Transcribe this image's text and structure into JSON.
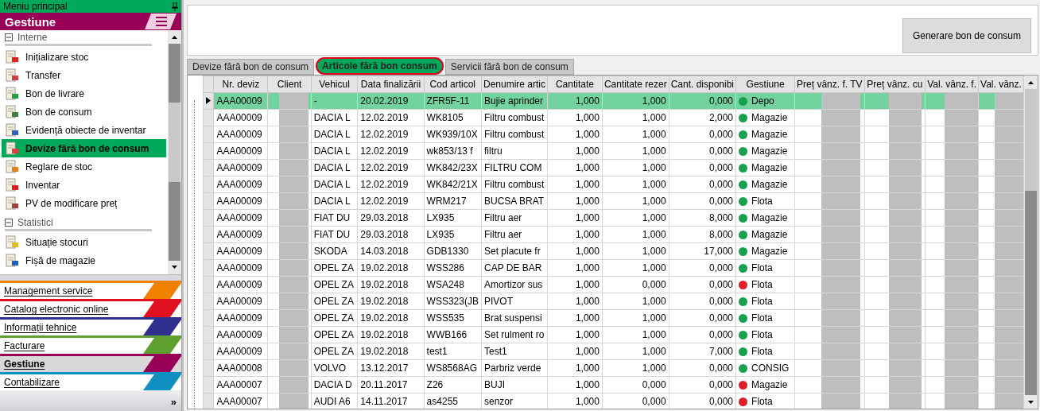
{
  "sidebar": {
    "title": "Meniu principal",
    "section": "Gestiune",
    "groups": [
      {
        "label": "Interne",
        "expanded": true,
        "items": [
          {
            "label": "Inițializare stoc",
            "selected": false,
            "color": "#e02020"
          },
          {
            "label": "Transfer",
            "selected": false,
            "color": "#d04040"
          },
          {
            "label": "Bon de livrare",
            "selected": false,
            "color": "#20a040"
          },
          {
            "label": "Bon de consum",
            "selected": false,
            "color": "#408040"
          },
          {
            "label": "Evidență obiecte de inventar",
            "selected": false,
            "color": "#3060c0"
          },
          {
            "label": "Devize fără bon de consum",
            "selected": true,
            "color": "#e04040"
          },
          {
            "label": "Reglare de stoc",
            "selected": false,
            "color": "#e08020"
          },
          {
            "label": "Inventar",
            "selected": false,
            "color": "#e02020"
          },
          {
            "label": "PV de modificare preț",
            "selected": false,
            "color": "#a04040"
          }
        ]
      },
      {
        "label": "Statistici",
        "expanded": true,
        "items": [
          {
            "label": "Situație stocuri",
            "selected": false,
            "color": "#e0c020"
          },
          {
            "label": "Fișă de magazie",
            "selected": false,
            "color": "#2060c0"
          }
        ]
      }
    ],
    "nav": [
      {
        "label": "Management service",
        "color": "#f08000",
        "selected": false
      },
      {
        "label": "Catalog electronic online",
        "color": "#e01020",
        "selected": false
      },
      {
        "label": "Informații tehnice",
        "color": "#303090",
        "selected": false
      },
      {
        "label": "Facturare",
        "color": "#60a030",
        "selected": false
      },
      {
        "label": "Gestiune",
        "color": "#980058",
        "selected": true
      },
      {
        "label": "Contabilizare",
        "color": "#1090c0",
        "selected": false
      }
    ],
    "more": "»"
  },
  "toolbar": {
    "button": "Generare bon de consum"
  },
  "tabs": [
    {
      "label": "Devize fără bon de consum",
      "selected": false
    },
    {
      "label": "Articole fără bon consum",
      "selected": true
    },
    {
      "label": "Servicii fără bon de consum",
      "selected": false
    }
  ],
  "table": {
    "columns": [
      {
        "label": "Nr. deviz",
        "kind": "text"
      },
      {
        "label": "Client",
        "kind": "redacted"
      },
      {
        "label": "Vehicul",
        "kind": "text"
      },
      {
        "label": "Data finalizării",
        "kind": "text"
      },
      {
        "label": "Cod articol",
        "kind": "text"
      },
      {
        "label": "Denumire artic",
        "kind": "text"
      },
      {
        "label": "Cantitate",
        "kind": "number"
      },
      {
        "label": "Cantitate rezer",
        "kind": "number"
      },
      {
        "label": "Cant. disponibi",
        "kind": "number"
      },
      {
        "label": "Gestiune",
        "kind": "status"
      },
      {
        "label": "Preț vânz. f. TV",
        "kind": "redacted"
      },
      {
        "label": "Preț vânz. cu",
        "kind": "redacted"
      },
      {
        "label": "Val. vânz. f.",
        "kind": "redacted"
      },
      {
        "label": "Val. vânz.",
        "kind": "redacted"
      }
    ],
    "rows": [
      {
        "selected": true,
        "color": "#16a050",
        "cells": [
          "AAA00009",
          "",
          "-",
          "20.02.2019",
          "ZFR5F-11",
          "Bujie aprinder",
          "1,000",
          "1,000",
          "0,000",
          "Depo"
        ]
      },
      {
        "selected": false,
        "color": "#16a050",
        "cells": [
          "AAA00009",
          "",
          "DACIA L",
          "12.02.2019",
          "WK8105",
          "Filtru combust",
          "1,000",
          "1,000",
          "2,000",
          "Magazie"
        ]
      },
      {
        "selected": false,
        "color": "#16a050",
        "cells": [
          "AAA00009",
          "",
          "DACIA L",
          "12.02.2019",
          "WK939/10X",
          "Filtru combust",
          "1,000",
          "1,000",
          "0,000",
          "Magazie"
        ]
      },
      {
        "selected": false,
        "color": "#16a050",
        "cells": [
          "AAA00009",
          "",
          "DACIA L",
          "12.02.2019",
          "wk853/13 f",
          "filtru",
          "1,000",
          "1,000",
          "0,000",
          "Magazie"
        ]
      },
      {
        "selected": false,
        "color": "#16a050",
        "cells": [
          "AAA00009",
          "",
          "DACIA L",
          "12.02.2019",
          "WK842/23X",
          "FILTRU COM",
          "1,000",
          "1,000",
          "0,000",
          "Magazie"
        ]
      },
      {
        "selected": false,
        "color": "#16a050",
        "cells": [
          "AAA00009",
          "",
          "DACIA L",
          "12.02.2019",
          "WK842/21X",
          "Filtru combust",
          "1,000",
          "1,000",
          "0,000",
          "Magazie"
        ]
      },
      {
        "selected": false,
        "color": "#16a050",
        "cells": [
          "AAA00009",
          "",
          "DACIA L",
          "12.02.2019",
          "WRM217",
          "BUCSA BRAT",
          "1,000",
          "1,000",
          "0,000",
          "Flota"
        ]
      },
      {
        "selected": false,
        "color": "#16a050",
        "cells": [
          "AAA00009",
          "",
          "FIAT DU",
          "29.03.2018",
          "LX935",
          "Filtru aer",
          "1,000",
          "1,000",
          "8,000",
          "Magazie"
        ]
      },
      {
        "selected": false,
        "color": "#16a050",
        "cells": [
          "AAA00009",
          "",
          "FIAT DU",
          "29.03.2018",
          "LX935",
          "Filtru aer",
          "1,000",
          "1,000",
          "8,000",
          "Magazie"
        ]
      },
      {
        "selected": false,
        "color": "#16a050",
        "cells": [
          "AAA00009",
          "",
          "SKODA",
          "14.03.2018",
          "GDB1330",
          "Set placute fr",
          "1,000",
          "1,000",
          "17,000",
          "Magazie"
        ]
      },
      {
        "selected": false,
        "color": "#16a050",
        "cells": [
          "AAA00009",
          "",
          "OPEL ZA",
          "19.02.2018",
          "WSS286",
          "CAP DE BAR",
          "1,000",
          "1,000",
          "0,000",
          "Flota"
        ]
      },
      {
        "selected": false,
        "color": "#e02028",
        "cells": [
          "AAA00009",
          "",
          "OPEL ZA",
          "19.02.2018",
          "WSA248",
          "Amortizor sus",
          "1,000",
          "0,000",
          "0,000",
          "Flota"
        ]
      },
      {
        "selected": false,
        "color": "#16a050",
        "cells": [
          "AAA00009",
          "",
          "OPEL ZA",
          "19.02.2018",
          "WSS323(JB",
          "PIVOT",
          "1,000",
          "1,000",
          "0,000",
          "Flota"
        ]
      },
      {
        "selected": false,
        "color": "#16a050",
        "cells": [
          "AAA00009",
          "",
          "OPEL ZA",
          "19.02.2018",
          "WSS535",
          "Brat suspensi",
          "1,000",
          "1,000",
          "0,000",
          "Flota"
        ]
      },
      {
        "selected": false,
        "color": "#16a050",
        "cells": [
          "AAA00009",
          "",
          "OPEL ZA",
          "19.02.2018",
          "WWB166",
          "Set rulment ro",
          "1,000",
          "1,000",
          "0,000",
          "Flota"
        ]
      },
      {
        "selected": false,
        "color": "#16a050",
        "cells": [
          "AAA00009",
          "",
          "OPEL ZA",
          "19.02.2018",
          "test1",
          "Test1",
          "1,000",
          "1,000",
          "7,000",
          "Flota"
        ]
      },
      {
        "selected": false,
        "color": "#16a050",
        "cells": [
          "AAA00008",
          "",
          "VOLVO",
          "13.12.2017",
          "WS8568AG",
          "Parbriz verde",
          "1,000",
          "1,000",
          "0,000",
          "CONSIG"
        ]
      },
      {
        "selected": false,
        "color": "#e02028",
        "cells": [
          "AAA00007",
          "",
          "DACIA D",
          "20.11.2017",
          "Z26",
          "BUJI",
          "1,000",
          "0,000",
          "0,000",
          "Magazie"
        ]
      },
      {
        "selected": false,
        "color": "#e02028",
        "cells": [
          "AAA00007",
          "",
          "AUDI A6",
          "14.11.2017",
          "as4255",
          "senzor",
          "1,000",
          "0,000",
          "0,000",
          "Flota"
        ]
      }
    ]
  }
}
